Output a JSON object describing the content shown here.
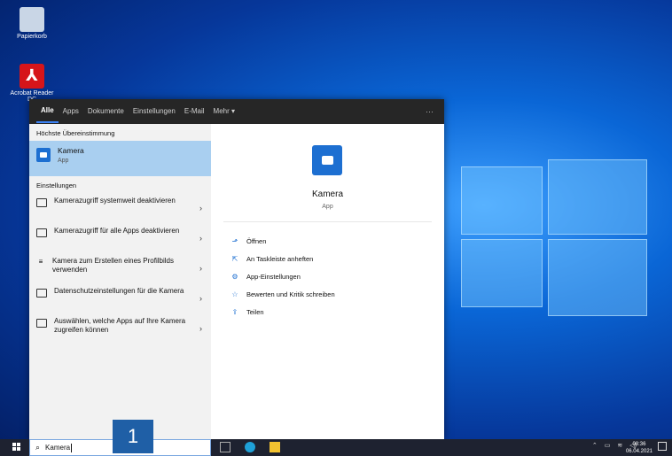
{
  "desktop": {
    "icons": [
      {
        "label": "Papierkorb",
        "icon": "recycle-bin-icon"
      },
      {
        "label": "Acrobat Reader DC",
        "icon": "acrobat-icon"
      }
    ]
  },
  "search_panel": {
    "tabs": [
      "Alle",
      "Apps",
      "Dokumente",
      "Einstellungen",
      "E-Mail",
      "Mehr ▾"
    ],
    "more_dots": "···",
    "best_match_heading": "Höchste Übereinstimmung",
    "best_match": {
      "title": "Kamera",
      "subtitle": "App"
    },
    "settings_heading": "Einstellungen",
    "settings_items": [
      {
        "text": "Kamerazugriff systemweit deaktivieren"
      },
      {
        "text": "Kamerazugriff für alle Apps deaktivieren"
      },
      {
        "text": "Kamera zum Erstellen eines Profilbilds verwenden"
      },
      {
        "text": "Datenschutzeinstellungen für die Kamera"
      },
      {
        "text": "Auswählen, welche Apps auf Ihre Kamera zugreifen können"
      }
    ],
    "detail": {
      "title": "Kamera",
      "subtitle": "App",
      "actions": [
        {
          "label": "Öffnen",
          "icon": "open-icon"
        },
        {
          "label": "An Taskleiste anheften",
          "icon": "pin-icon"
        },
        {
          "label": "App-Einstellungen",
          "icon": "gear-icon"
        },
        {
          "label": "Bewerten und Kritik schreiben",
          "icon": "star-icon"
        },
        {
          "label": "Teilen",
          "icon": "share-icon"
        }
      ]
    }
  },
  "taskbar": {
    "search_value": "Kamera",
    "callout_number": "1",
    "clock_time": "08:36",
    "clock_date": "06.04.2021"
  },
  "colors": {
    "accent": "#1d6fd1",
    "best_match_bg": "#a9cff0",
    "topbar_bg": "#262626"
  }
}
